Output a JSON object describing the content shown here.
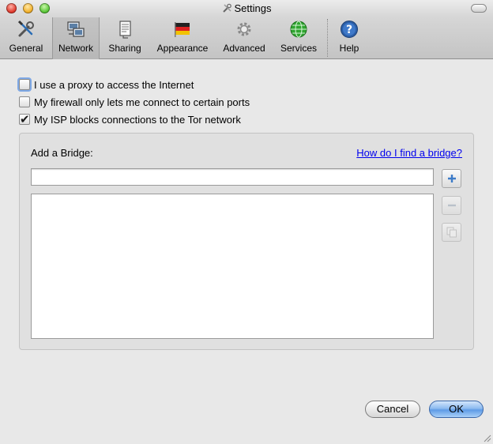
{
  "window": {
    "title": "Settings"
  },
  "toolbar": {
    "items": [
      {
        "label": "General",
        "icon": "wrench-screwdriver-icon"
      },
      {
        "label": "Network",
        "icon": "network-computer-icon"
      },
      {
        "label": "Sharing",
        "icon": "sharing-document-icon"
      },
      {
        "label": "Appearance",
        "icon": "flag-icon"
      },
      {
        "label": "Advanced",
        "icon": "gear-icon"
      },
      {
        "label": "Services",
        "icon": "globe-icon"
      },
      {
        "label": "Help",
        "icon": "help-icon"
      }
    ],
    "selected": "Network"
  },
  "network": {
    "proxy_label": "I use a proxy to access the Internet",
    "proxy_checked": false,
    "firewall_label": "My firewall only lets me connect to certain ports",
    "firewall_checked": false,
    "isp_label": "My ISP blocks connections to the Tor network",
    "isp_checked": true
  },
  "bridges": {
    "heading": "Add a Bridge:",
    "help_link": "How do I find a bridge?",
    "input_value": "",
    "list": []
  },
  "buttons": {
    "cancel": "Cancel",
    "ok": "OK"
  },
  "colors": {
    "link": "#0000ee",
    "default_button": "#5e9be6"
  }
}
